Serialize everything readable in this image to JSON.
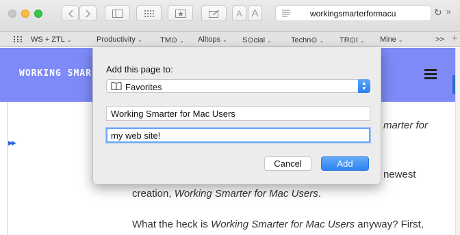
{
  "toolbar": {
    "address": "workingsmarterformacu"
  },
  "bookmarks": {
    "items": [
      {
        "label": "WS + ZTL",
        "caret": "⌄"
      },
      {
        "label": "Productivity",
        "caret": "⌄"
      },
      {
        "label": "TM⊙",
        "caret": "⌄"
      },
      {
        "label": "Alltops",
        "caret": "⌄"
      },
      {
        "label": "S⊙cial",
        "caret": "⌄"
      },
      {
        "label": "Techn⊙",
        "caret": "⌄"
      },
      {
        "label": "TR⊙I",
        "caret": "⌄"
      },
      {
        "label": "Mine",
        "caret": "⌄"
      }
    ],
    "overflow": ">>",
    "plus": "+"
  },
  "page": {
    "brand": "WORKING SMAR",
    "fragment_1": "marter for",
    "fragment_2": "",
    "fragment_3": "newest",
    "line_a_pre": "creation, ",
    "line_a_italic": "Working Smarter for Mac Users",
    "line_a_post": ".",
    "line_b_pre": "What the heck is ",
    "line_b_italic": "Working Smarter for Mac Users",
    "line_b_post": " anyway? First,"
  },
  "dialog": {
    "title": "Add this page to:",
    "folder": "Favorites",
    "page_title_value": "Working Smarter for Mac Users",
    "description_value": "my web site!",
    "cancel_label": "Cancel",
    "add_label": "Add"
  }
}
